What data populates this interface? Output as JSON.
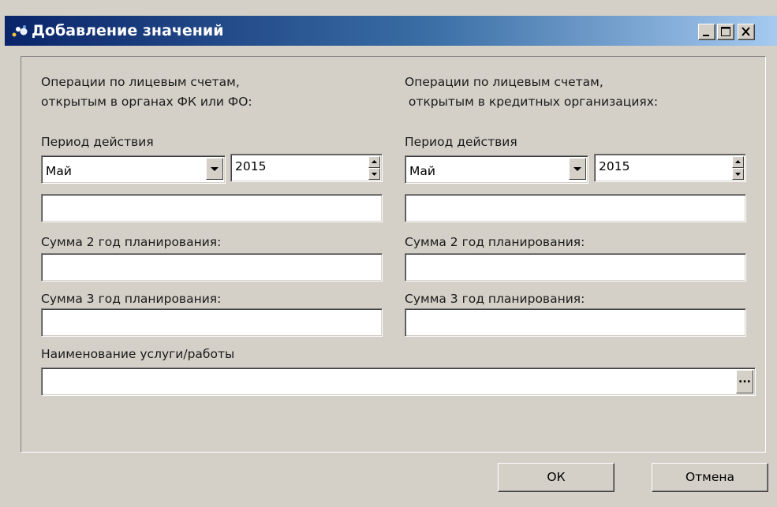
{
  "window": {
    "title": "Добавление значений",
    "minimize_label": "_",
    "maximize_label": "□",
    "close_label": "×"
  },
  "left": {
    "heading_line1": "Операции по лицевым счетам,",
    "heading_line2": "открытым в органах ФК или ФО:",
    "period_label": "Период действия",
    "month": "Май",
    "year": "2015",
    "amount_value": "",
    "sum2_label": "Сумма 2 год планирования:",
    "sum2_value": "",
    "sum3_label": "Сумма 3 год планирования:",
    "sum3_value": ""
  },
  "right": {
    "heading_line1": "Операции по лицевым счетам,",
    "heading_line2": " открытым в кредитных организациях:",
    "period_label": "Период действия",
    "month": "Май",
    "year": "2015",
    "amount_value": "",
    "sum2_label": "Сумма 2 год планирования:",
    "sum2_value": "",
    "sum3_label": "Сумма 3 год планирования:",
    "sum3_value": ""
  },
  "service": {
    "label": "Наименование услуги/работы",
    "value": "",
    "browse_label": "..."
  },
  "buttons": {
    "ok": "ОК",
    "cancel": "Отмена"
  },
  "colors": {
    "titlebar_start": "#0a246a",
    "titlebar_end": "#a6caf0",
    "window_bg": "#d4d0c8"
  },
  "icons": {
    "app": "app-window-icon",
    "dropdown": "chevron-down-icon",
    "spin_up": "spin-up-icon",
    "spin_down": "spin-down-icon"
  }
}
